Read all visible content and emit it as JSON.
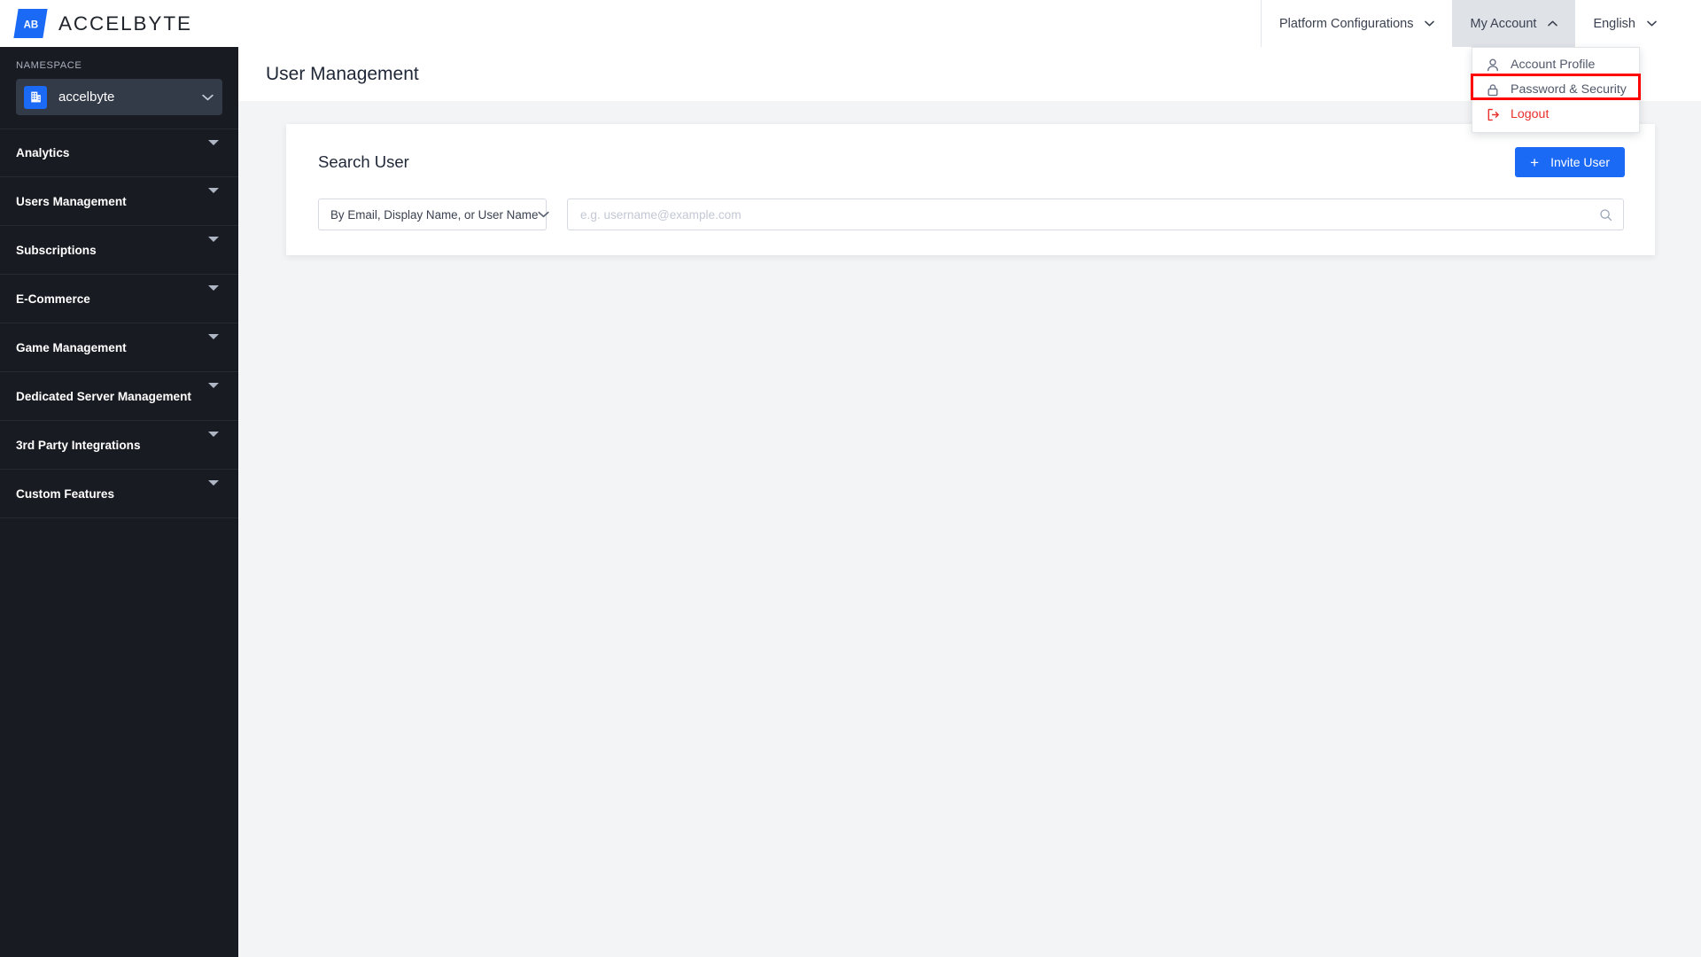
{
  "brand": {
    "name": "ACCELBYTE",
    "mark_text": "AB",
    "accent": "#1B6AF5"
  },
  "topnav": {
    "items": [
      {
        "label": "Platform Configurations",
        "icon": "chevron-down-icon",
        "active": false
      },
      {
        "label": "My Account",
        "icon": "chevron-up-icon",
        "active": true
      },
      {
        "label": "English",
        "icon": "chevron-down-icon",
        "active": false
      }
    ]
  },
  "account_menu": {
    "items": [
      {
        "label": "Account Profile",
        "icon": "user-icon",
        "danger": false
      },
      {
        "label": "Password & Security",
        "icon": "lock-icon",
        "danger": false,
        "highlighted": true
      },
      {
        "label": "Logout",
        "icon": "logout-icon",
        "danger": true
      }
    ],
    "highlight_color": "#FF0000",
    "danger_color": "#E8302C"
  },
  "sidebar": {
    "namespace_label": "NAMESPACE",
    "namespace_value": "accelbyte",
    "namespace_icon": "building-icon",
    "namespace_caret": "chevron-down-icon",
    "items": [
      {
        "label": "Analytics",
        "icon": "caret-down-icon"
      },
      {
        "label": "Users Management",
        "icon": "caret-down-icon"
      },
      {
        "label": "Subscriptions",
        "icon": "caret-down-icon"
      },
      {
        "label": "E-Commerce",
        "icon": "caret-down-icon"
      },
      {
        "label": "Game Management",
        "icon": "caret-down-icon"
      },
      {
        "label": "Dedicated Server Management",
        "icon": "caret-down-icon"
      },
      {
        "label": "3rd Party Integrations",
        "icon": "caret-down-icon"
      },
      {
        "label": "Custom Features",
        "icon": "caret-down-icon"
      }
    ]
  },
  "page": {
    "title": "User Management"
  },
  "search_card": {
    "title": "Search User",
    "invite_button": {
      "label": "Invite User",
      "icon": "plus-icon",
      "color": "#1B6AF5"
    },
    "filter_select": {
      "value": "By Email, Display Name, or User Name",
      "icon": "chevron-down-icon"
    },
    "search_field": {
      "value": "",
      "placeholder": "e.g. username@example.com",
      "icon": "search-icon"
    }
  }
}
